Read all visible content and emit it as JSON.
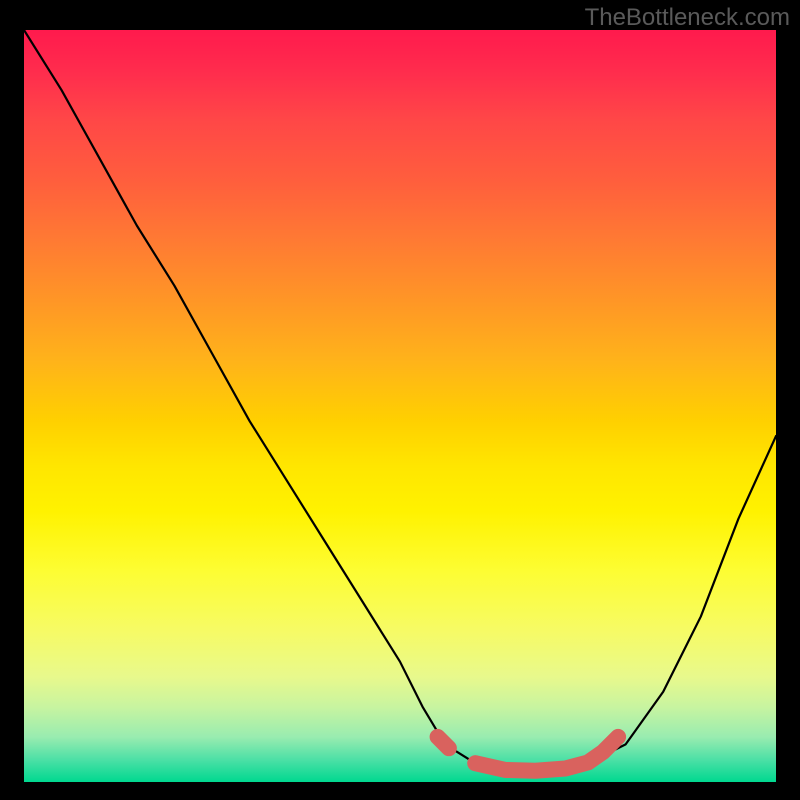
{
  "watermark": "TheBottleneck.com",
  "chart_data": {
    "type": "line",
    "title": "",
    "xlabel": "",
    "ylabel": "",
    "xlim": [
      0,
      100
    ],
    "ylim": [
      0,
      100
    ],
    "series": [
      {
        "name": "curve",
        "x": [
          0,
          5,
          10,
          15,
          20,
          25,
          30,
          35,
          40,
          45,
          50,
          53,
          56,
          60,
          65,
          70,
          75,
          80,
          85,
          90,
          95,
          100
        ],
        "y": [
          100,
          92,
          83,
          74,
          66,
          57,
          48,
          40,
          32,
          24,
          16,
          10,
          5,
          2.5,
          1.5,
          1.5,
          2.5,
          5,
          12,
          22,
          35,
          46
        ]
      }
    ],
    "highlight": {
      "name": "bottleneck-range",
      "color": "#d9625e",
      "segments": [
        {
          "x": [
            55,
            56.5
          ],
          "y": [
            6,
            4.5
          ]
        },
        {
          "x": [
            60,
            64,
            68,
            72,
            75,
            77,
            79
          ],
          "y": [
            2.5,
            1.6,
            1.5,
            1.8,
            2.6,
            4.0,
            6.0
          ]
        }
      ]
    }
  }
}
